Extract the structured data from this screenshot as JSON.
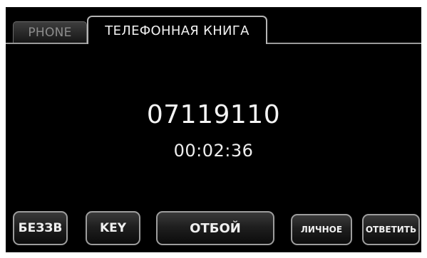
{
  "tabs": {
    "phone": "PHONE",
    "phonebook": "ТЕЛЕФОННАЯ КНИГА"
  },
  "call": {
    "number": "07119110",
    "duration": "00:02:36"
  },
  "buttons": {
    "mute": "БЕЗЗВ",
    "key": "KEY",
    "end": "ОТБОЙ",
    "private": "ЛИЧНОЕ",
    "answer": "ОТВЕТИТЬ"
  },
  "colors": {
    "background": "#000000",
    "border": "#9d9d9d",
    "text": "#f0f0f0",
    "inactive_tab_text": "#8c8c8c"
  }
}
